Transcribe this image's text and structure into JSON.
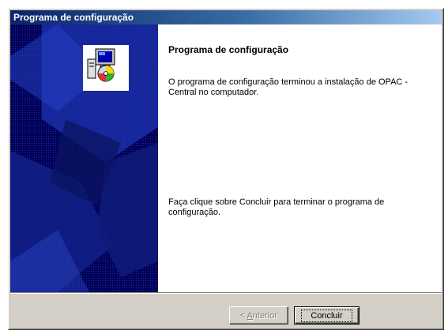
{
  "window": {
    "title": "Programa de configuração"
  },
  "content": {
    "heading": "Programa de configuração",
    "message": "O programa de configuração terminou a instalação de OPAC - Central no computador.",
    "instruction": "Faça clique sobre Concluir para terminar o programa de configuração."
  },
  "buttons": {
    "back_arrow": "<",
    "back_access_key": "A",
    "back_rest": "nterior",
    "back_enabled": false,
    "finish_label": "Concluir"
  },
  "icons": {
    "setup": "setup-computer-icon"
  },
  "colors": {
    "titlebar_start": "#0a246a",
    "titlebar_end": "#a6caf0",
    "panel_bg": "#000060",
    "dialog_face": "#d4d0c8"
  }
}
